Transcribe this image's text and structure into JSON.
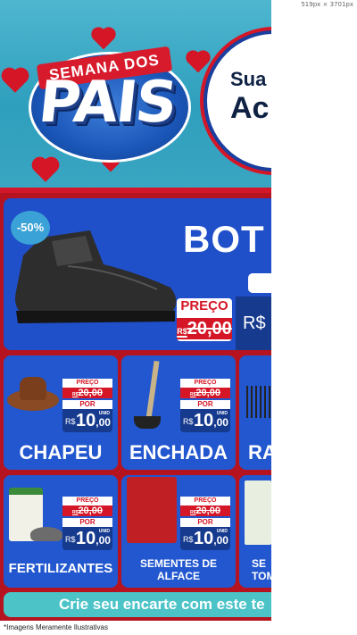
{
  "banner": {
    "ribbon_text": "SEMANA DOS",
    "title": "PAIS",
    "promo_line1": "Sua",
    "promo_line2": "Ac"
  },
  "hero": {
    "discount_badge": "-50%",
    "name": "BOT",
    "price_label": "PREÇO",
    "old_price": "20,00",
    "currency_prefix_old": "R$",
    "currency": "R$"
  },
  "products": [
    {
      "name": "CHAPEU",
      "price_label": "PREÇO",
      "currency_prefix_old": "R$",
      "old_price": "20,00",
      "por_label": "POR",
      "currency": "R$",
      "new_price": "10",
      "new_cents": ",00",
      "unit": "UNID"
    },
    {
      "name": "ENCHADA",
      "price_label": "PREÇO",
      "currency_prefix_old": "R$",
      "old_price": "20,00",
      "por_label": "POR",
      "currency": "R$",
      "new_price": "10",
      "new_cents": ",00",
      "unit": "UNID"
    },
    {
      "name": "RA"
    },
    {
      "name": "FERTILIZANTES",
      "price_label": "PREÇO",
      "currency_prefix_old": "R$",
      "old_price": "20,00",
      "por_label": "POR",
      "currency": "R$",
      "new_price": "10",
      "new_cents": ",00",
      "unit": "UNID"
    },
    {
      "name": "SEMENTES DE ALFACE",
      "price_label": "PREÇO",
      "currency_prefix_old": "R$",
      "old_price": "20,00",
      "por_label": "POR",
      "currency": "R$",
      "new_price": "10",
      "new_cents": ",00",
      "unit": "UNID"
    },
    {
      "name": "SE TOM"
    }
  ],
  "cta": {
    "text": "Crie seu encarte com este te"
  },
  "footnote": "*Imagens Meramente Ilustrativas",
  "canvas_size_label": "519px × 3701px",
  "colors": {
    "brand_red": "#b5131f",
    "card_blue": "#2257cf",
    "price_navy": "#163a8e",
    "cta_teal": "#4bc3c7"
  }
}
